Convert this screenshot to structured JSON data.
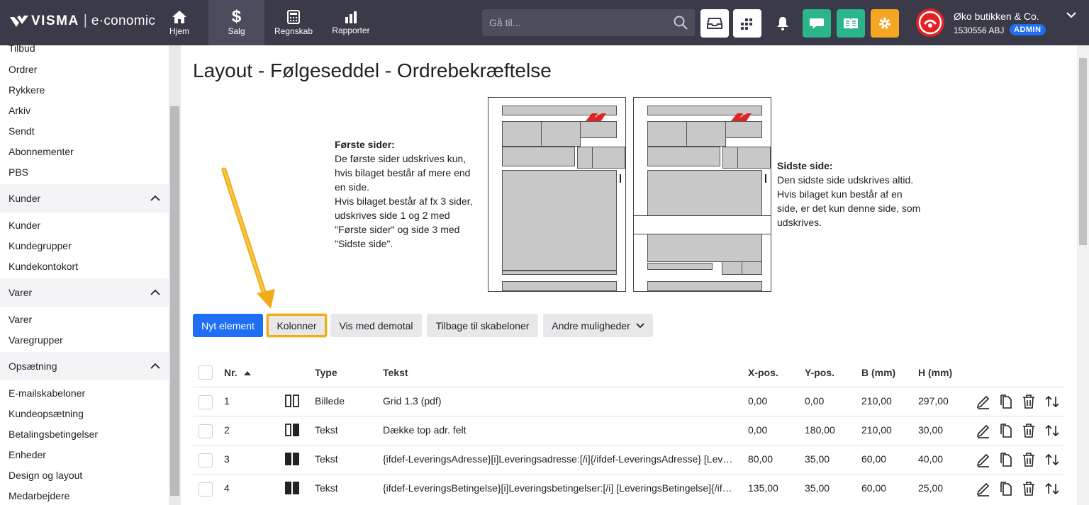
{
  "app": {
    "brand": "VISMA",
    "separator": "|",
    "product": "e·conomic"
  },
  "nav": {
    "items": [
      {
        "label": "Hjem",
        "icon": "home-icon"
      },
      {
        "label": "Salg",
        "icon": "dollar-icon",
        "active": true
      },
      {
        "label": "Regnskab",
        "icon": "calculator-icon"
      },
      {
        "label": "Rapporter",
        "icon": "bar-chart-icon"
      }
    ]
  },
  "search": {
    "placeholder": "Gå til..."
  },
  "toolbar_icons": [
    {
      "icon": "inbox-icon",
      "color": "#ffffff"
    },
    {
      "icon": "apps-grid-icon",
      "color": "#ffffff"
    },
    {
      "icon": "bell-icon",
      "color": "#ffffff"
    },
    {
      "icon": "chat-icon",
      "color": "#2bb58a"
    },
    {
      "icon": "book-icon",
      "color": "#2bb58a"
    },
    {
      "icon": "gear-icon",
      "color": "#f5a623"
    }
  ],
  "company": {
    "name": "Øko butikken & Co.",
    "id": "1530556 ABJ",
    "role": "ADMIN"
  },
  "sidebar": {
    "partial_top": "Tilbud",
    "sales_items": [
      "Ordrer",
      "Rykkere",
      "Arkiv",
      "Sendt",
      "Abonnementer",
      "PBS"
    ],
    "groups": [
      {
        "title": "Kunder",
        "items": [
          "Kunder",
          "Kundegrupper",
          "Kundekontokort"
        ]
      },
      {
        "title": "Varer",
        "items": [
          "Varer",
          "Varegrupper"
        ]
      },
      {
        "title": "Opsætning",
        "items": [
          "E-mailskabeloner",
          "Kundeopsætning",
          "Betalingsbetingelser",
          "Enheder",
          "Design og layout",
          "Medarbejdere"
        ]
      }
    ]
  },
  "page": {
    "title": "Layout - Følgeseddel - Ordrebekræftelse",
    "first_pages": {
      "heading": "Første sider:",
      "lines": [
        "De første sider udskrives kun,",
        "hvis bilaget består af mere end",
        "en side.",
        "Hvis bilaget består af fx 3 sider,",
        "udskrives side 1 og 2 med",
        "\"Første sider\" og side 3 med",
        "\"Sidste side\"."
      ]
    },
    "last_page": {
      "heading": "Sidste side:",
      "lines": [
        "Den sidste side udskrives altid.",
        "Hvis bilaget kun består af en",
        "side, er det kun denne side, som",
        "udskrives."
      ]
    }
  },
  "actions": {
    "new_element": "Nyt element",
    "columns": "Kolonner",
    "show_demo": "Vis med demotal",
    "back": "Tilbage til skabeloner",
    "more": "Andre muligheder"
  },
  "table": {
    "headers": {
      "nr": "Nr.",
      "type": "Type",
      "text": "Tekst",
      "x": "X-pos.",
      "y": "Y-pos.",
      "w": "B (mm)",
      "h": "H (mm)"
    },
    "rows": [
      {
        "nr": "1",
        "column_icon": "columns-outline-icon",
        "type": "Billede",
        "text": "Grid 1.3 (pdf)",
        "x": "0,00",
        "y": "0,00",
        "w": "210,00",
        "h": "297,00"
      },
      {
        "nr": "2",
        "column_icon": "columns-half-icon",
        "type": "Tekst",
        "text": "Dække top adr. felt",
        "x": "0,00",
        "y": "180,00",
        "w": "210,00",
        "h": "30,00"
      },
      {
        "nr": "3",
        "column_icon": "columns-filled-icon",
        "type": "Tekst",
        "text": "{ifdef-LeveringsAdresse}[i]Leveringsadresse:[/i]{/ifdef-LeveringsAdresse} [LeveringsAdresse]",
        "x": "80,00",
        "y": "35,00",
        "w": "60,00",
        "h": "40,00"
      },
      {
        "nr": "4",
        "column_icon": "columns-filled-icon",
        "type": "Tekst",
        "text": "{ifdef-LeveringsBetingelse}[i]Leveringsbetingelser:[/i] [LeveringsBetingelse]{/ifdef-LeveringsBetingelse}",
        "x": "135,00",
        "y": "35,00",
        "w": "60,00",
        "h": "25,00"
      }
    ]
  },
  "colors": {
    "topbar": "#3a3a48",
    "primary": "#1f6ff5",
    "highlight": "#f0ac18"
  }
}
